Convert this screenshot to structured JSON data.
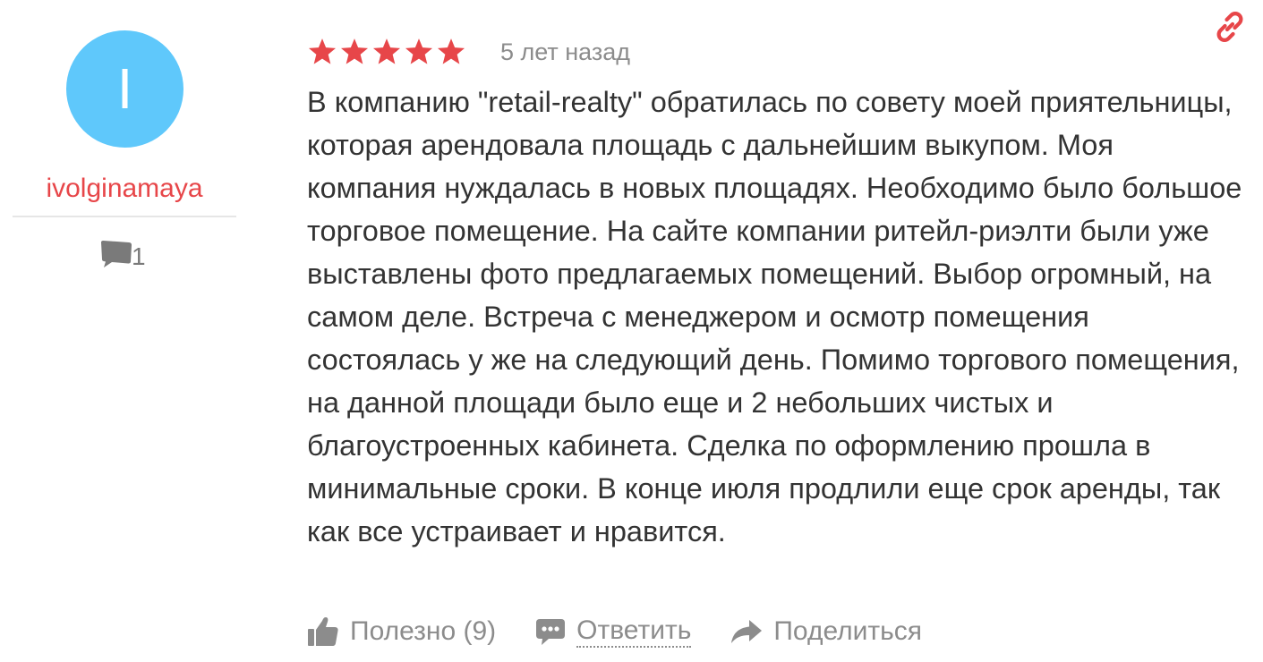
{
  "author": {
    "avatar_letter": "I",
    "avatar_color": "#5fc8fb",
    "name": "ivolginamaya",
    "name_color": "#e74649",
    "comments_icon": "comment-icon",
    "comments_count": "1"
  },
  "review": {
    "rating": 5,
    "rating_max": 5,
    "star_color": "#e74649",
    "date": "5 лет назад",
    "text": "В компанию \"retail-realty\" обратилась по совету моей приятельницы, которая арендовала площадь с дальнейшим выкупом. Моя компания нуждалась в новых площадях. Необходимо было большое торговое помещение. На сайте компании ритейл-риэлти были уже выставлены фото предлагаемых помещений. Выбор огромный, на самом деле. Встреча с менеджером и осмотр помещения состоялась у же на следующий день. Помимо торгового помещения, на данной площади было еще и 2 небольших чистых и благоустроенных кабинета. Сделка по оформлению прошла в минимальные сроки. В конце июля продлили еще срок аренды, так как все устраивает и нравится."
  },
  "actions": {
    "useful_label": "Полезно (9)",
    "useful_icon": "thumbs-up-icon",
    "reply_label": "Ответить",
    "reply_icon": "speech-bubble-icon",
    "share_label": "Поделиться",
    "share_icon": "share-arrow-icon"
  },
  "permalink_icon": "link-icon",
  "accent_color": "#e74649"
}
